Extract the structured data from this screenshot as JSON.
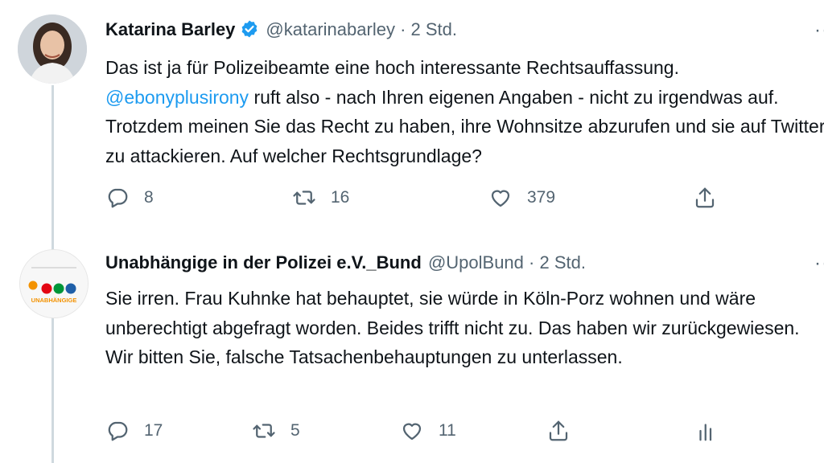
{
  "tweets": [
    {
      "author_name": "Katarina Barley",
      "handle": "@katarinabarley",
      "separator": "·",
      "time": "2 Std.",
      "verified": true,
      "more": "··",
      "text_before_mention": "Das ist ja für Polizeibeamte eine hoch interessante Rechtsauffassung.",
      "mention": "@ebonyplusirony",
      "text_after_mention": " ruft also - nach Ihren eigenen Angaben - nicht zu irgendwas auf. Trotzdem meinen Sie das Recht zu haben, ihre Wohnsitze abzurufen und sie auf Twitter zu attackieren. Auf welcher Rechtsgrundlage?",
      "replies": "8",
      "retweets": "16",
      "likes": "379",
      "icons": [
        "reply-icon",
        "retweet-icon",
        "like-icon",
        "share-icon"
      ]
    },
    {
      "author_name": "Unabhängige in der Polizei e.V._Bund",
      "handle": "@UpolBund",
      "separator": "·",
      "time": "2 Std.",
      "verified": false,
      "more": "··",
      "avatar_text": "UNABHÄNGIGE",
      "text": "Sie irren. Frau Kuhnke hat behauptet, sie würde in Köln-Porz wohnen und wäre unberechtigt abgefragt worden. Beides trifft nicht zu. Das haben wir zurückgewiesen. Wir bitten Sie, falsche Tatsachenbehauptungen zu unterlassen.",
      "replies": "17",
      "retweets": "5",
      "likes": "11",
      "icons": [
        "reply-icon",
        "retweet-icon",
        "like-icon",
        "share-icon",
        "analytics-icon"
      ]
    }
  ],
  "colors": {
    "accent": "#1d9bf0",
    "secondary_text": "#536471",
    "thread_line": "#cfd9de"
  }
}
